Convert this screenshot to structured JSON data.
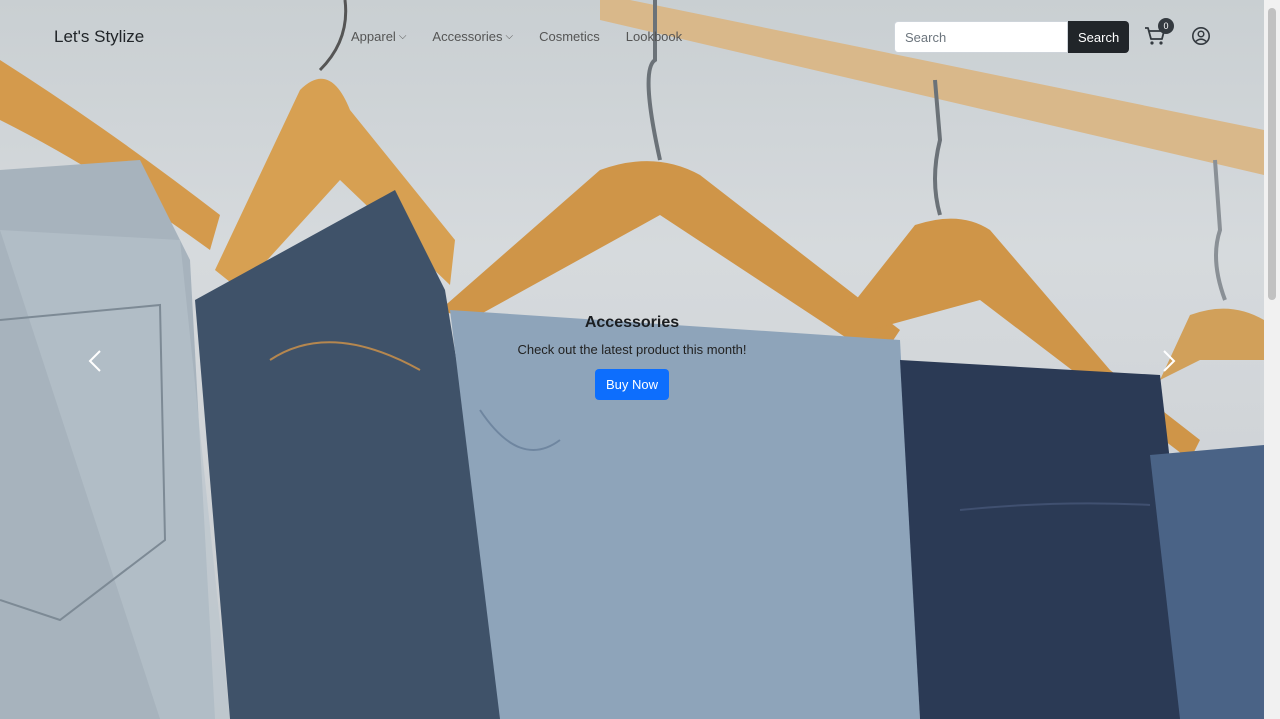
{
  "brand": "Let's Stylize",
  "nav": {
    "items": [
      {
        "label": "Apparel",
        "dropdown": true
      },
      {
        "label": "Accessories",
        "dropdown": true
      },
      {
        "label": "Cosmetics",
        "dropdown": false
      },
      {
        "label": "Lookbook",
        "dropdown": false
      }
    ]
  },
  "search": {
    "placeholder": "Search",
    "button_label": "Search"
  },
  "cart": {
    "count": "0",
    "icon": "cart-icon"
  },
  "account": {
    "icon": "user-circle-icon"
  },
  "carousel": {
    "caption_title": "Accessories",
    "caption_text": "Check out the latest product this month!",
    "button_label": "Buy Now",
    "prev_icon": "chevron-left-icon",
    "next_icon": "chevron-right-icon"
  },
  "colors": {
    "primary": "#0d6efd",
    "dark": "#212529"
  }
}
